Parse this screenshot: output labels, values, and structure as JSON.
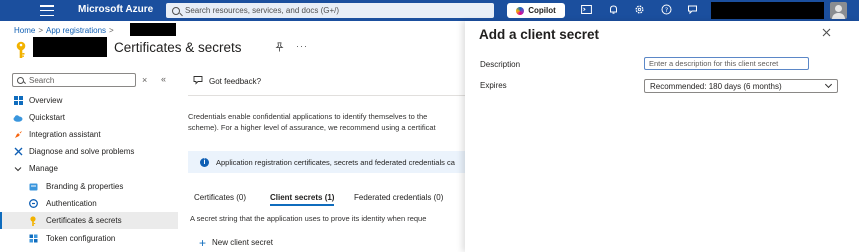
{
  "topbar": {
    "brand": "Microsoft Azure",
    "search_placeholder": "Search resources, services, and docs (G+/)",
    "copilot_label": "Copilot",
    "bg_color": "#1b4f9e"
  },
  "breadcrumb": {
    "items": [
      "Home",
      "App registrations"
    ],
    "separator": ">"
  },
  "page": {
    "title": "Certificates & secrets",
    "more": "···"
  },
  "nav": {
    "search_placeholder": "Search",
    "clear": "×",
    "collapse": "«",
    "items": [
      {
        "label": "Overview",
        "icon": "grid-icon"
      },
      {
        "label": "Quickstart",
        "icon": "cloud-icon"
      },
      {
        "label": "Integration assistant",
        "icon": "rocket-icon"
      },
      {
        "label": "Diagnose and solve problems",
        "icon": "wrench-icon"
      },
      {
        "label": "Manage",
        "icon": "chevron-down-icon"
      },
      {
        "label": "Branding & properties",
        "icon": "branding-icon"
      },
      {
        "label": "Authentication",
        "icon": "authentication-icon"
      },
      {
        "label": "Certificates & secrets",
        "icon": "key-icon",
        "selected": true
      },
      {
        "label": "Token configuration",
        "icon": "token-icon"
      }
    ]
  },
  "main": {
    "feedback": "Got feedback?",
    "description_line1": "Credentials enable confidential applications to identify themselves to the",
    "description_line2": "scheme). For a higher level of assurance, we recommend using a certificat",
    "info": "Application registration certificates, secrets and federated credentials ca",
    "tabs": [
      {
        "label": "Certificates (0)"
      },
      {
        "label": "Client secrets (1)",
        "active": true
      },
      {
        "label": "Federated credentials (0)"
      }
    ],
    "secret_desc": "A secret string that the application uses to prove its identity when reque",
    "new_secret": "New client secret"
  },
  "panel": {
    "title": "Add a client secret",
    "description_label": "Description",
    "description_placeholder": "Enter a description for this client secret",
    "expires_label": "Expires",
    "expires_value": "Recommended: 180 days (6 months)"
  },
  "colors": {
    "accent": "#0f6cbd",
    "info_bg": "#ebf3fc"
  }
}
